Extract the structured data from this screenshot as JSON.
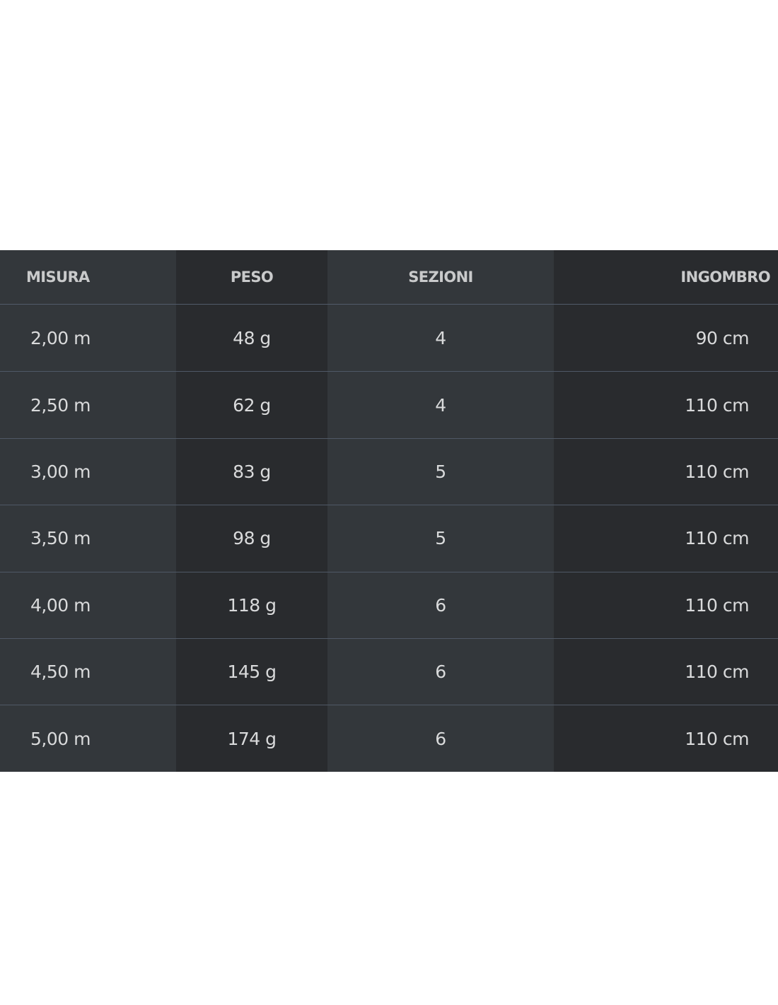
{
  "table": {
    "headers": [
      "MISURA",
      "PESO",
      "SEZIONI",
      "INGOMBRO"
    ],
    "rows": [
      [
        "2,00 m",
        "48 g",
        "4",
        "90 cm"
      ],
      [
        "2,50 m",
        "62 g",
        "4",
        "110 cm"
      ],
      [
        "3,00 m",
        "83 g",
        "5",
        "110 cm"
      ],
      [
        "3,50 m",
        "98 g",
        "5",
        "110 cm"
      ],
      [
        "4,00 m",
        "118 g",
        "6",
        "110 cm"
      ],
      [
        "4,50 m",
        "145 g",
        "6",
        "110 cm"
      ],
      [
        "5,00 m",
        "174 g",
        "6",
        "110 cm"
      ]
    ]
  },
  "colors": {
    "page_background": "#ffffff",
    "light_column": "#33373b",
    "dark_column": "#292b2e",
    "divider": "#4f5866",
    "text": "#d9dadb"
  }
}
